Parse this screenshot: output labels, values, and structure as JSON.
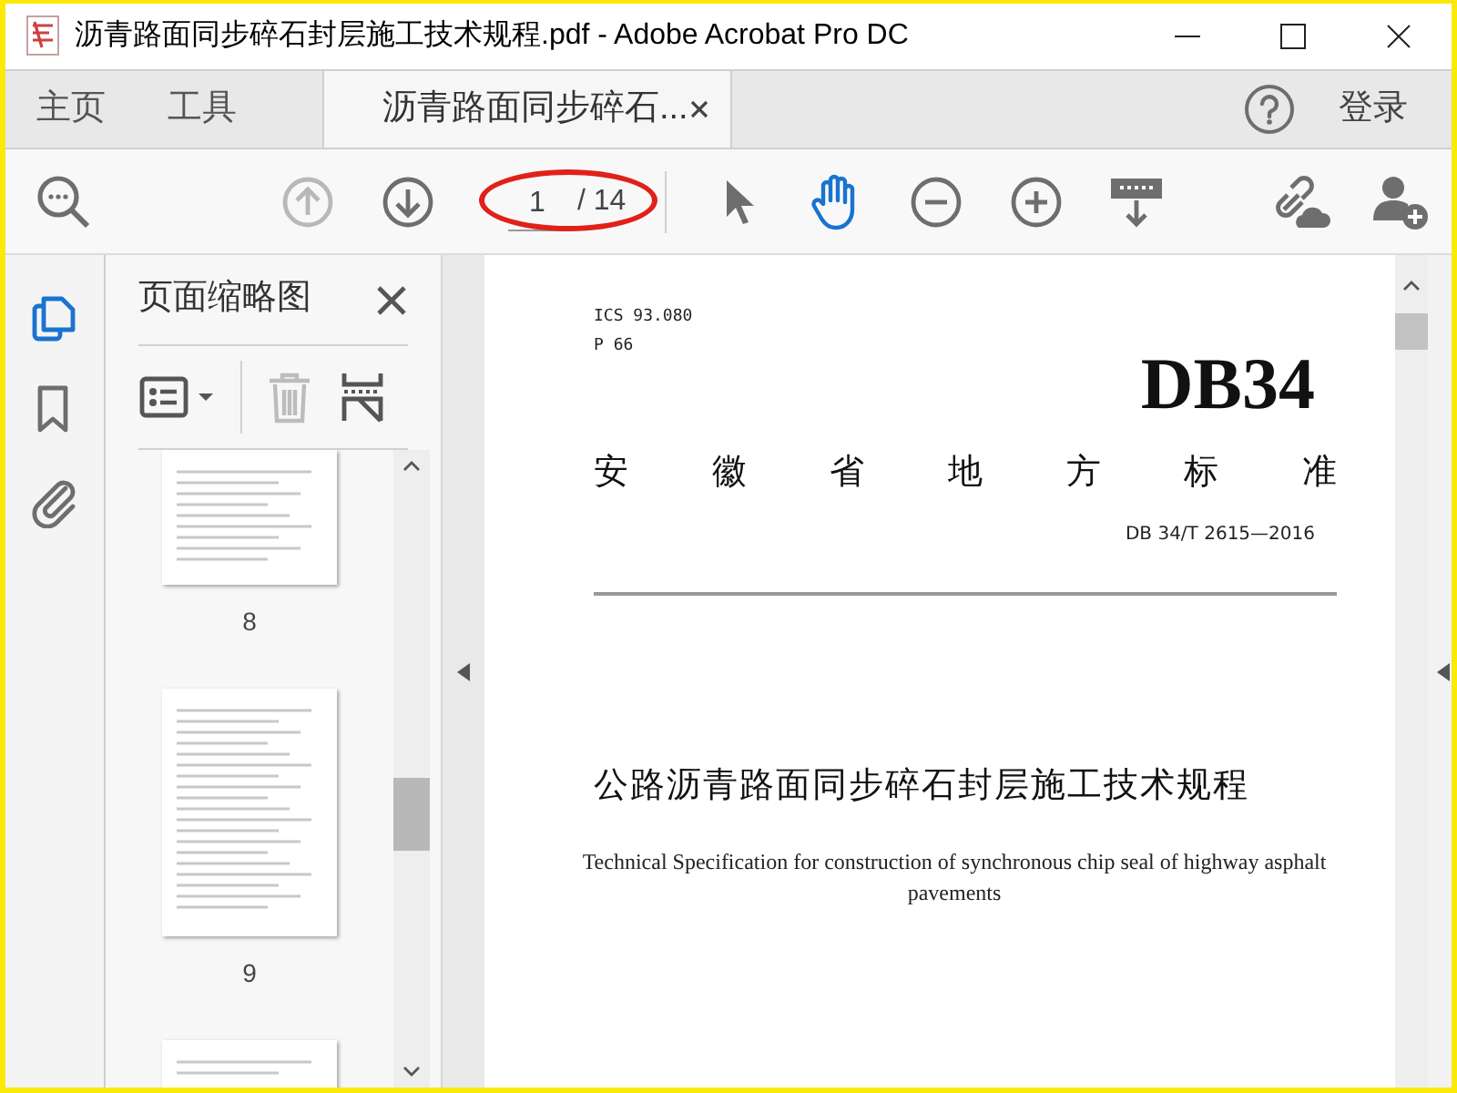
{
  "window": {
    "title": "沥青路面同步碎石封层施工技术规程.pdf - Adobe Acrobat Pro DC"
  },
  "tabs": [
    {
      "label": "主页",
      "selected": false
    },
    {
      "label": "工具",
      "selected": false
    },
    {
      "label": "沥青路面同步碎石...",
      "selected": true
    }
  ],
  "account": {
    "sign_in": "登录"
  },
  "toolbar": {
    "page_number": "1",
    "page_total": "/ 14",
    "page_highlighted": true,
    "tools": [
      {
        "kind": "select",
        "selected": false
      },
      {
        "kind": "hand",
        "selected": true
      }
    ]
  },
  "side_rail": [
    {
      "kind": "pages",
      "selected": true
    },
    {
      "kind": "bookmarks",
      "selected": false
    },
    {
      "kind": "attachments",
      "selected": false
    }
  ],
  "thumbnail_panel": {
    "title": "页面缩略图",
    "thumbnails": [
      {
        "label": "8"
      },
      {
        "label": "9"
      }
    ]
  },
  "document": {
    "ics": "ICS 93.080",
    "class_code": "P 66",
    "logo": "DB34",
    "standard_type": "安 徽 省 地 方 标 准",
    "standard_number": "DB 34/T 2615—2016",
    "title_cn": "公路沥青路面同步碎石封层施工技术规程",
    "title_en": "Technical Specification for construction of synchronous chip seal of highway asphalt pavements"
  }
}
